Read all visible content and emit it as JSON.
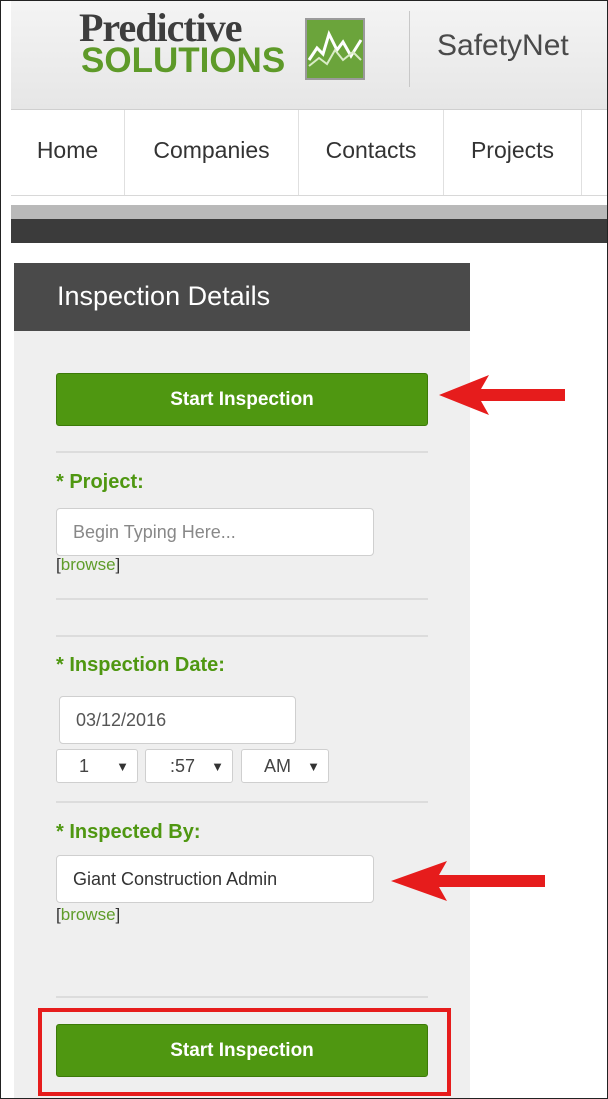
{
  "header": {
    "logo_line1": "Predictive",
    "logo_line2": "SOLUTIONS",
    "app_name": "SafetyNet"
  },
  "nav": {
    "items": [
      "Home",
      "Companies",
      "Contacts",
      "Projects"
    ]
  },
  "panel": {
    "title": "Inspection Details",
    "start_button_top": "Start Inspection",
    "project": {
      "label": "* Project:",
      "placeholder": "Begin Typing Here...",
      "browse_open": "[",
      "browse_link": "browse",
      "browse_close": "]"
    },
    "inspection_date": {
      "label": "* Inspection Date:",
      "date_value": "03/12/2016",
      "hour": "1",
      "minute": ":57",
      "ampm": "AM"
    },
    "inspected_by": {
      "label": "* Inspected By:",
      "value": "Giant Construction Admin",
      "browse_open": "[",
      "browse_link": "browse",
      "browse_close": "]"
    },
    "start_button_bottom": "Start Inspection"
  },
  "icons": {
    "dropdown_caret": "▼"
  },
  "colors": {
    "brand_green": "#4f9711",
    "logo_gray": "#3d3d3d",
    "panel_header": "#4a4a4a",
    "annotation_red": "#e61c1c"
  }
}
